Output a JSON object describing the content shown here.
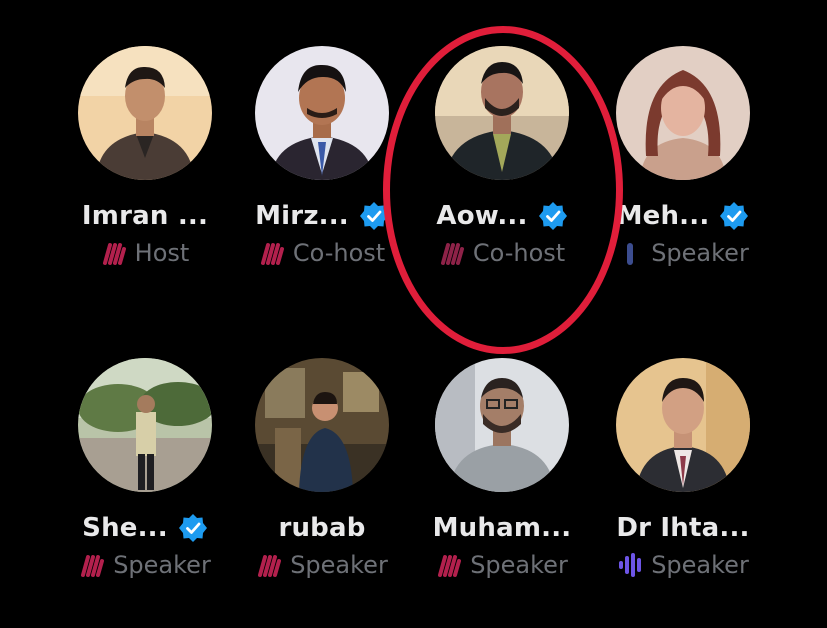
{
  "colors": {
    "background": "#000000",
    "verified": "#1d9bf0",
    "speaking_pink": "#e0245e",
    "speaking_purple": "#7856ff",
    "highlight_ring": "#e01e3a"
  },
  "participants": [
    {
      "name": "Imran ...",
      "role": "Host",
      "verified": false,
      "role_icon": "speaking-pink-icon"
    },
    {
      "name": "Mirz...",
      "role": "Co-host",
      "verified": true,
      "role_icon": "speaking-pink-icon"
    },
    {
      "name": "Aow...",
      "role": "Co-host",
      "verified": true,
      "role_icon": "speaking-pink-icon"
    },
    {
      "name": "Meh...",
      "role": "Speaker",
      "verified": true,
      "role_icon": "speaking-blue-icon"
    },
    {
      "name": "She...",
      "role": "Speaker",
      "verified": true,
      "role_icon": "speaking-pink-icon"
    },
    {
      "name": "rubab",
      "role": "Speaker",
      "verified": false,
      "role_icon": "speaking-pink-icon"
    },
    {
      "name": "Muham...",
      "role": "Speaker",
      "verified": false,
      "role_icon": "speaking-pink-icon"
    },
    {
      "name": "Dr Ihta...",
      "role": "Speaker",
      "verified": false,
      "role_icon": "speaking-purple-icon"
    }
  ]
}
